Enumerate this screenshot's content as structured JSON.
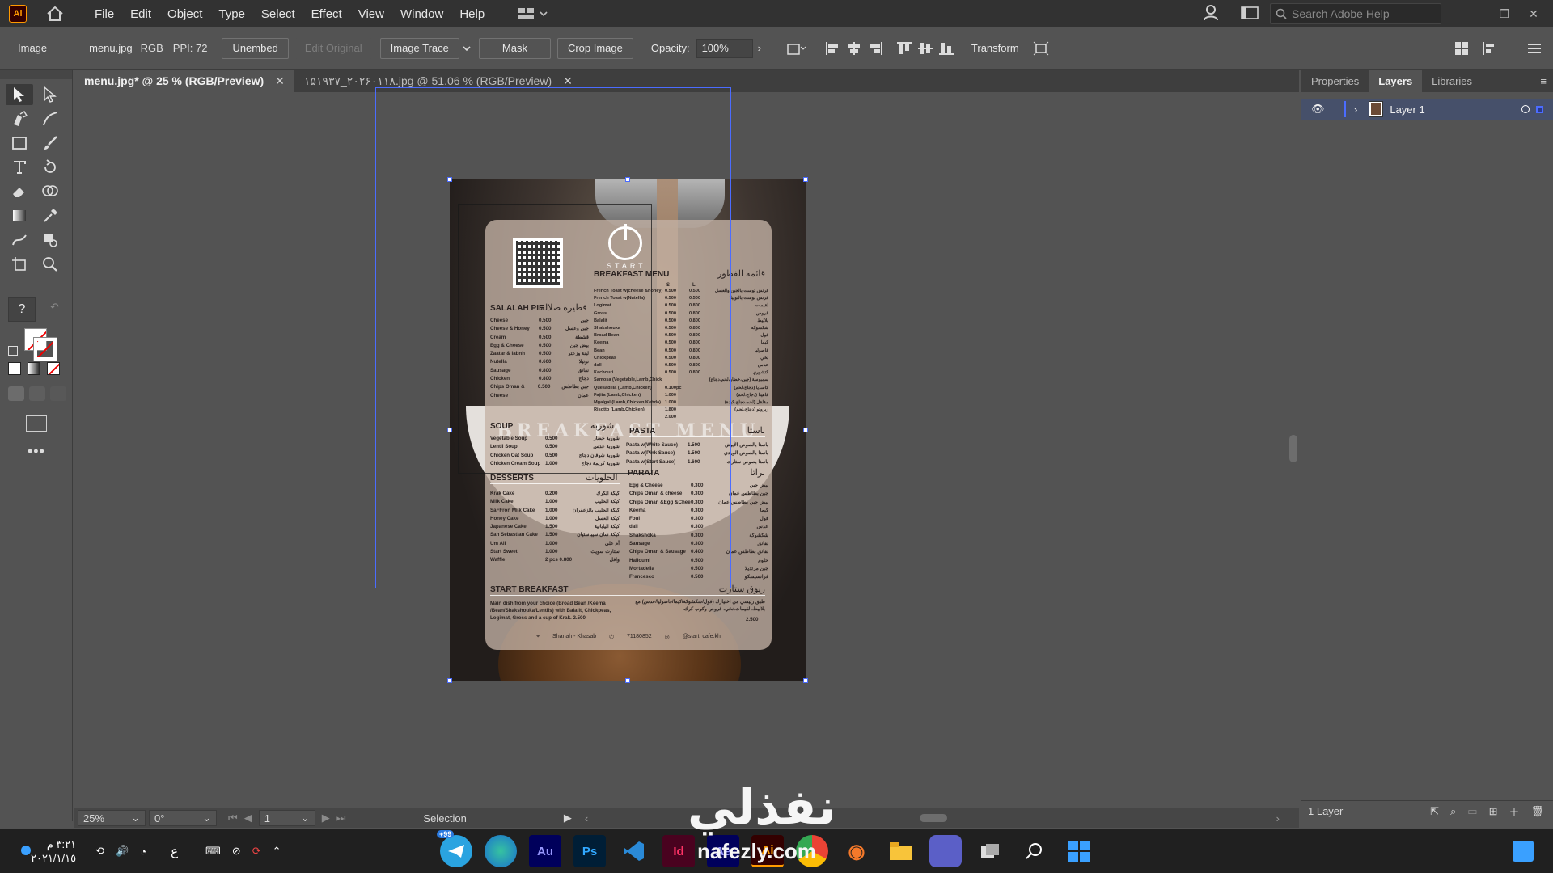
{
  "app": {
    "logo": "Ai"
  },
  "menubar": {
    "items": [
      "File",
      "Edit",
      "Object",
      "Type",
      "Select",
      "Effect",
      "View",
      "Window",
      "Help"
    ],
    "search_placeholder": "Search Adobe Help"
  },
  "controlbar": {
    "object_type": "Image",
    "file_link": "menu.jpg",
    "color_mode": "RGB",
    "ppi": "PPI: 72",
    "unembed": "Unembed",
    "edit_original": "Edit Original",
    "image_trace": "Image Trace",
    "mask": "Mask",
    "crop_image": "Crop Image",
    "opacity_label": "Opacity:",
    "opacity_value": "100%",
    "transform": "Transform"
  },
  "tabs": [
    {
      "label": "menu.jpg* @ 25 % (RGB/Preview)",
      "active": true
    },
    {
      "label": "۱۵۱۹۳۷_۲۰۲۶۰۱۱۸.jpg @ 51.06 % (RGB/Preview)",
      "active": false
    }
  ],
  "artwork": {
    "logo_text": "START",
    "watermark": "BREAKFAST MENU",
    "breakfast": {
      "title_en": "BREAKFAST MENU",
      "title_ar": "قائمة الفطور",
      "size_s": "S",
      "size_l": "L",
      "items": [
        [
          "French Toast w(cheese &honey)",
          "0.500",
          "0.500",
          "فرنش توست بالجبن والعسل"
        ],
        [
          "French Toast w(Nutella)",
          "0.500",
          "0.500",
          "فرنش توست بالنوتيلا"
        ],
        [
          "Logimat",
          "0.500",
          "0.800",
          "لقيمات"
        ],
        [
          "Gross",
          "0.500",
          "0.800",
          "قروص"
        ],
        [
          "Balalit",
          "0.500",
          "0.800",
          "بلاليط"
        ],
        [
          "Shakshouka",
          "0.500",
          "0.800",
          "شكشوكة"
        ],
        [
          "Broad Bean",
          "0.500",
          "0.800",
          "فول"
        ],
        [
          "Keema",
          "0.500",
          "0.800",
          "كيما"
        ],
        [
          "Bean",
          "0.500",
          "0.800",
          "فاصوليا"
        ],
        [
          "Chickpeas",
          "0.500",
          "0.800",
          "نخي"
        ],
        [
          "dall",
          "0.500",
          "0.800",
          "عدس"
        ],
        [
          "Kachouri",
          "0.500",
          "0.800",
          "كتشوري"
        ],
        [
          "Samosa (Vegetable,Lamb,Chicken)",
          "",
          "",
          "سمبوسة (جبن،خضار،لحم،دجاج)"
        ],
        [
          "Quesadilla (Lamb,Chicken)",
          "0.100pc",
          "",
          "كاسديا (دجاج،لحم)"
        ],
        [
          "Fajita (Lamb,Chicken)",
          "1.000",
          "",
          "فاهيتا (دجاج،لحم)"
        ],
        [
          "Mgalgal (Lamb,Chicken,Kebda)",
          "1.000",
          "",
          "مقلقل (لحم،دجاج،كبدة)"
        ],
        [
          "Risotto (Lamb,Chicken)",
          "1.800",
          "",
          "ريزوتو (دجاج،لحم)"
        ],
        [
          "",
          "2.000",
          "",
          ""
        ]
      ]
    },
    "salalah": {
      "title_en": "SALALAH PIE",
      "title_ar": "فطيرة صلالة",
      "items": [
        [
          "Cheese",
          "0.500",
          "جبن"
        ],
        [
          "Cheese & Honey",
          "0.500",
          "جبن وعسل"
        ],
        [
          "Cream",
          "0.500",
          "قشطة"
        ],
        [
          "Egg & Cheese",
          "0.500",
          "بيض جبن"
        ],
        [
          "Zaatar & labnh",
          "0.500",
          "لبنة وزعتر"
        ],
        [
          "Nutella",
          "0.600",
          "نوتيلا"
        ],
        [
          "Sausage",
          "0.800",
          "نقانق"
        ],
        [
          "Chicken",
          "0.800",
          "دجاج"
        ],
        [
          "Chips Oman &",
          "0.500",
          "جبن بطاطس"
        ],
        [
          "Cheese",
          "",
          "عمان"
        ]
      ]
    },
    "soup": {
      "title_en": "SOUP",
      "title_ar": "شوربة",
      "items": [
        [
          "Vegetable Soup",
          "0.500",
          "شوربة خضار"
        ],
        [
          "Lentil Soup",
          "0.500",
          "شوربة عدس"
        ],
        [
          "Chicken Oat Soup",
          "0.500",
          "شوربة شوفان دجاج"
        ],
        [
          "Chicken Cream Soup",
          "1.000",
          "شوربة كريمة دجاج"
        ]
      ]
    },
    "pasta": {
      "title_en": "PASTA",
      "title_ar": "باستا",
      "items": [
        [
          "Pasta w(White Sauce)",
          "1.500",
          "باستا بالصوص الأبيض"
        ],
        [
          "Pasta w(Pink Sauce)",
          "1.500",
          "باستا بالصوص الوردي"
        ],
        [
          "Pasta w(Start Sauce)",
          "1.600",
          "باستا بصوص ستارت"
        ]
      ]
    },
    "desserts": {
      "title_en": "DESSERTS",
      "title_ar": "الحلويات",
      "items": [
        [
          "Krak Cake",
          "0.200",
          "كيكة الكرك"
        ],
        [
          "Milk Cake",
          "1.000",
          "كيكة الحليب"
        ],
        [
          "SaFFron Milk Cake",
          "1.000",
          "كيكة الحليب بالزعفران"
        ],
        [
          "Honey Cake",
          "1.000",
          "كيكة العسل"
        ],
        [
          "Japanese Cake",
          "1.500",
          "كيكة اليابانية"
        ],
        [
          "San Sebastian Cake",
          "1.500",
          "كيكة سان سيباستيان"
        ],
        [
          "Um Ali",
          "1.000",
          "أم علي"
        ],
        [
          "Start Sweet",
          "1.000",
          "ستارت سويت"
        ],
        [
          "",
          "",
          ""
        ],
        [
          "Waffle",
          "2 pcs 0.800",
          "وافل"
        ]
      ]
    },
    "parata": {
      "title_en": "PARATA",
      "title_ar": "براتا",
      "items": [
        [
          "Egg & Cheese",
          "0.300",
          "بيض جبن"
        ],
        [
          "Chips Oman & cheese",
          "0.300",
          "جبن بطاطس عمان"
        ],
        [
          "Chips Oman &Egg &Cheese",
          "0.300",
          "بيض جبن بطاطس عمان"
        ],
        [
          "Keema",
          "0.300",
          "كيما"
        ],
        [
          "Foul",
          "0.300",
          "فول"
        ],
        [
          "dall",
          "0.300",
          "عدس"
        ],
        [
          "Shakshoka",
          "0.300",
          "شكشوكة"
        ],
        [
          "Sausage",
          "0.300",
          "نقانق"
        ],
        [
          "Chips Oman & Sausage",
          "0.400",
          "نقانق بطاطس عمان"
        ],
        [
          "Halloumi",
          "0.500",
          "حلوم"
        ],
        [
          "Mortadella",
          "0.500",
          "جبن مرتديلا"
        ],
        [
          "Francesco",
          "0.500",
          "فرانسيسكو"
        ]
      ]
    },
    "start_breakfast": {
      "title_en": "START BREAKFAST",
      "title_ar": "ريوق ستارت",
      "desc_en": "Main dish from your choice (Broad Bean /Keema /Bean/Shakshouka/Lentils) with Balalit, Chickpeas, Logimat, Gross and a cup of Krak. 2.500",
      "desc_ar": "طبق رئيسي من اختيارك (فول/شكشوكة/كيما/فاصوليا/عدس) مع بلاليط، لقيمات،نخي، قروص وكوب كرك.",
      "price": "2.500"
    },
    "footer": {
      "location": "Sharjah - Khasab",
      "phone": "71180852",
      "instagram": "@start_cafe.kh"
    }
  },
  "statusbar": {
    "zoom": "25%",
    "rotation": "0°",
    "artboard": "1",
    "tool": "Selection"
  },
  "panel": {
    "tabs": [
      "Properties",
      "Layers",
      "Libraries"
    ],
    "layer_name": "Layer 1",
    "footer": "1 Layer"
  },
  "taskbar": {
    "time": "٣:٢١ م",
    "date": "٢٠٢١/١/١٥",
    "lang": "ع",
    "badge": "+99",
    "apps": [
      "Au",
      "Ps",
      "Id",
      "Ae",
      "Ai"
    ]
  },
  "watermark": {
    "logo": "نفذلي",
    "url": "nafezly.com"
  },
  "colors": {
    "accent": "#4b6cff",
    "ai_orange": "#ff9a00"
  }
}
